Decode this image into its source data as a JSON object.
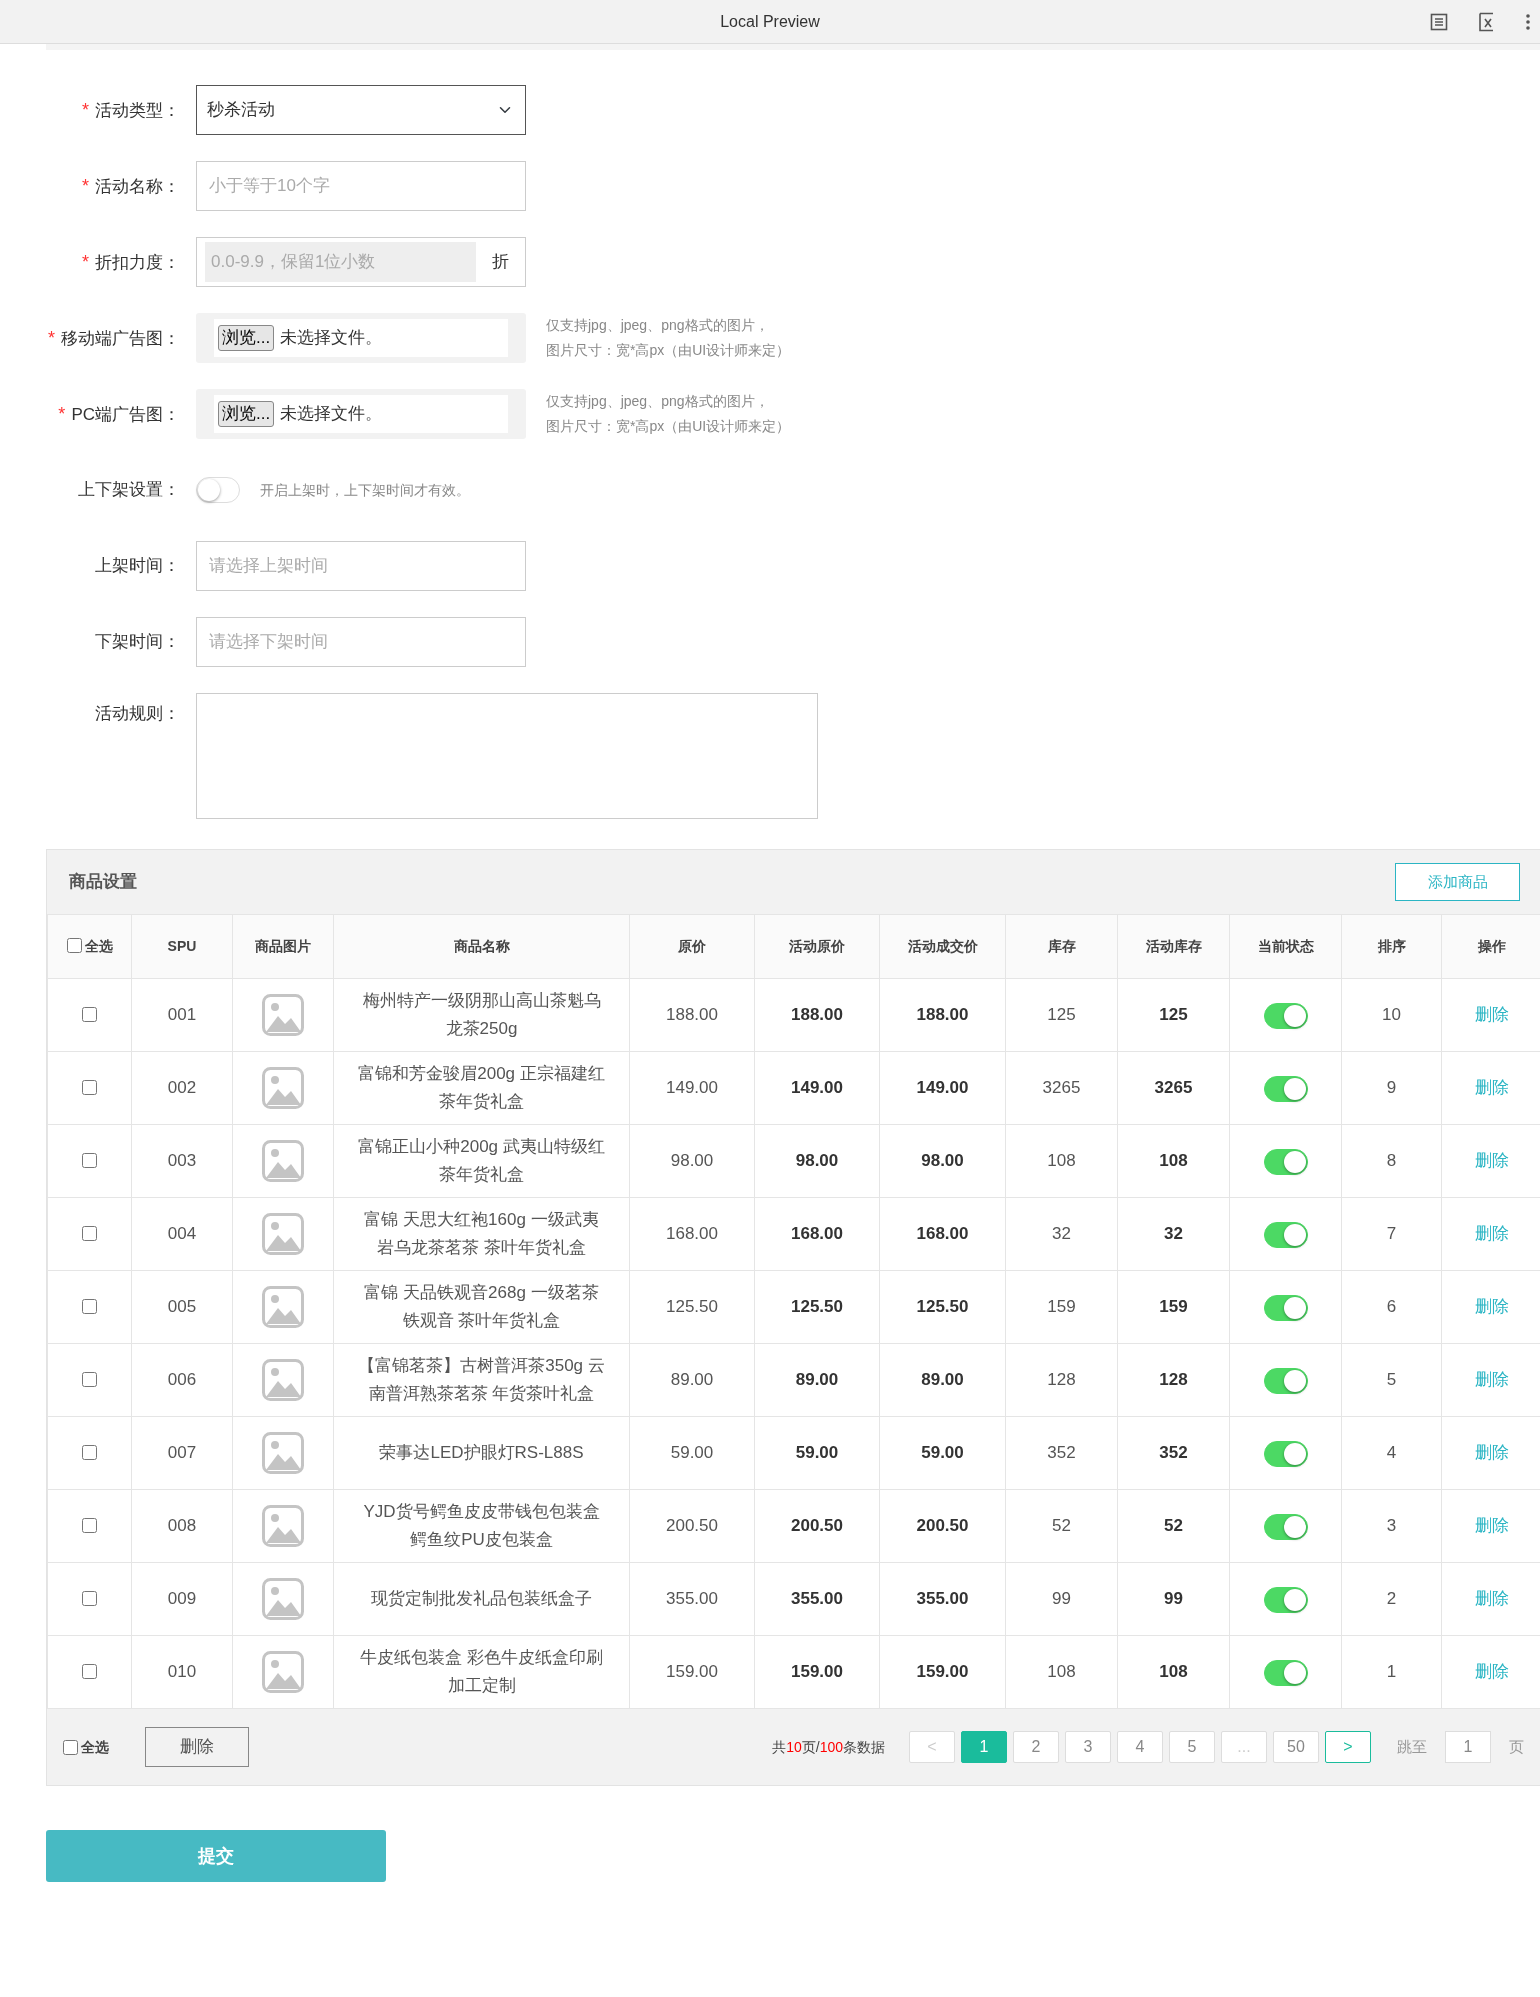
{
  "window": {
    "title": "Local Preview"
  },
  "form": {
    "fields": [
      {
        "kind": "select",
        "label": "活动类型：",
        "required_mark": "*",
        "value": "秒杀活动"
      },
      {
        "kind": "text",
        "label": "活动名称：",
        "required_mark": "*",
        "placeholder": "小于等于10个字"
      },
      {
        "kind": "suffix",
        "label": "折扣力度：",
        "required_mark": "*",
        "placeholder": "0.0-9.9，保留1位小数",
        "suffix": "折"
      },
      {
        "kind": "file",
        "label": "移动端广告图：",
        "required_mark": "*",
        "button": "浏览...",
        "file_text": "未选择文件。",
        "hint_lines": [
          "仅支持jpg、jpeg、png格式的图片，",
          "图片尺寸：宽*高px（由UI设计师来定）"
        ]
      },
      {
        "kind": "file",
        "label": "PC端广告图：",
        "required_mark": "*",
        "button": "浏览...",
        "file_text": "未选择文件。",
        "hint_lines": [
          "仅支持jpg、jpeg、png格式的图片，",
          "图片尺寸：宽*高px（由UI设计师来定）"
        ]
      },
      {
        "kind": "switch",
        "label": "上下架设置：",
        "on": false,
        "hint_lines": [
          "开启上架时，上下架时间才有效。"
        ]
      },
      {
        "kind": "text",
        "label": "上架时间：",
        "placeholder": "请选择上架时间"
      },
      {
        "kind": "text",
        "label": "下架时间：",
        "placeholder": "请选择下架时间"
      },
      {
        "kind": "textarea",
        "label": "活动规则："
      }
    ]
  },
  "products": {
    "title": "商品设置",
    "add_button": "添加商品",
    "select_all": {
      "label": "全选",
      "checked": false
    },
    "columns": [
      "SPU",
      "商品图片",
      "商品名称",
      "原价",
      "活动原价",
      "活动成交价",
      "库存",
      "活动库存",
      "当前状态",
      "排序",
      "操作"
    ],
    "rows": [
      {
        "checked": false,
        "spu": "001",
        "name": "梅州特产一级阴那山高山茶魁乌龙茶250g",
        "price": "188.00",
        "activity_price": "188.00",
        "deal_price": "188.00",
        "stock": "125",
        "activity_stock": "125",
        "on": true,
        "sort": "10",
        "action": "删除"
      },
      {
        "checked": false,
        "spu": "002",
        "name": "富锦和芳金骏眉200g 正宗福建红茶年货礼盒",
        "price": "149.00",
        "activity_price": "149.00",
        "deal_price": "149.00",
        "stock": "3265",
        "activity_stock": "3265",
        "on": true,
        "sort": "9",
        "action": "删除"
      },
      {
        "checked": false,
        "spu": "003",
        "name": "富锦正山小种200g 武夷山特级红茶年货礼盒",
        "price": "98.00",
        "activity_price": "98.00",
        "deal_price": "98.00",
        "stock": "108",
        "activity_stock": "108",
        "on": true,
        "sort": "8",
        "action": "删除"
      },
      {
        "checked": false,
        "spu": "004",
        "name": "富锦 天思大红袍160g 一级武夷岩乌龙茶茗茶 茶叶年货礼盒",
        "price": "168.00",
        "activity_price": "168.00",
        "deal_price": "168.00",
        "stock": "32",
        "activity_stock": "32",
        "on": true,
        "sort": "7",
        "action": "删除"
      },
      {
        "checked": false,
        "spu": "005",
        "name": "富锦 天品铁观音268g 一级茗茶铁观音 茶叶年货礼盒",
        "price": "125.50",
        "activity_price": "125.50",
        "deal_price": "125.50",
        "stock": "159",
        "activity_stock": "159",
        "on": true,
        "sort": "6",
        "action": "删除"
      },
      {
        "checked": false,
        "spu": "006",
        "name": "【富锦茗茶】古树普洱茶350g 云南普洱熟茶茗茶 年货茶叶礼盒",
        "price": "89.00",
        "activity_price": "89.00",
        "deal_price": "89.00",
        "stock": "128",
        "activity_stock": "128",
        "on": true,
        "sort": "5",
        "action": "删除"
      },
      {
        "checked": false,
        "spu": "007",
        "name": "荣事达LED护眼灯RS-L88S",
        "price": "59.00",
        "activity_price": "59.00",
        "deal_price": "59.00",
        "stock": "352",
        "activity_stock": "352",
        "on": true,
        "sort": "4",
        "action": "删除"
      },
      {
        "checked": false,
        "spu": "008",
        "name": "YJD货号鳄鱼皮皮带钱包包装盒鳄鱼纹PU皮包装盒",
        "price": "200.50",
        "activity_price": "200.50",
        "deal_price": "200.50",
        "stock": "52",
        "activity_stock": "52",
        "on": true,
        "sort": "3",
        "action": "删除"
      },
      {
        "checked": false,
        "spu": "009",
        "name": "现货定制批发礼品包装纸盒子",
        "price": "355.00",
        "activity_price": "355.00",
        "deal_price": "355.00",
        "stock": "99",
        "activity_stock": "99",
        "on": true,
        "sort": "2",
        "action": "删除"
      },
      {
        "checked": false,
        "spu": "010",
        "name": "牛皮纸包装盒 彩色牛皮纸盒印刷加工定制",
        "price": "159.00",
        "activity_price": "159.00",
        "deal_price": "159.00",
        "stock": "108",
        "activity_stock": "108",
        "on": true,
        "sort": "1",
        "action": "删除"
      }
    ],
    "footer": {
      "select_all": {
        "label": "全选",
        "checked": false
      },
      "delete_button": "删除",
      "summary": {
        "prefix": "共",
        "pages": "10",
        "middle": "页/",
        "total": "100",
        "suffix": "条数据"
      },
      "pages": [
        {
          "kind": "prev",
          "label": "<",
          "disabled": true,
          "selected": false
        },
        {
          "kind": "page",
          "label": "1",
          "disabled": false,
          "selected": true
        },
        {
          "kind": "page",
          "label": "2",
          "disabled": false,
          "selected": false
        },
        {
          "kind": "page",
          "label": "3",
          "disabled": false,
          "selected": false
        },
        {
          "kind": "page",
          "label": "4",
          "disabled": false,
          "selected": false
        },
        {
          "kind": "page",
          "label": "5",
          "disabled": false,
          "selected": false
        },
        {
          "kind": "ellipsis",
          "label": "...",
          "disabled": true,
          "selected": false
        },
        {
          "kind": "page",
          "label": "50",
          "disabled": false,
          "selected": false
        },
        {
          "kind": "next",
          "label": ">",
          "disabled": false,
          "selected": false
        }
      ],
      "jump_label": "跳至",
      "jump_value": "1",
      "jump_unit": "页"
    }
  },
  "submit_button": "提交"
}
